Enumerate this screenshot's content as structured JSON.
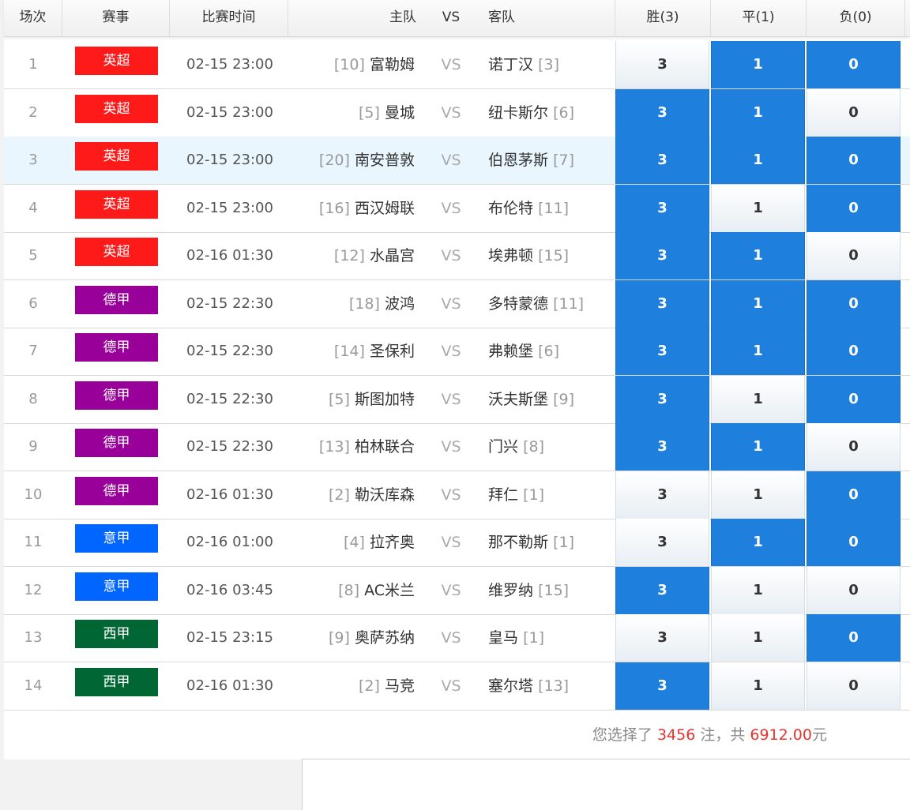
{
  "header": {
    "num": "场次",
    "league": "赛事",
    "time": "比赛时间",
    "home": "主队",
    "vs": "VS",
    "away": "客队",
    "win": "胜(3)",
    "draw": "平(1)",
    "lose": "负(0)"
  },
  "league_colors": {
    "英超": "#ff1a1a",
    "德甲": "#990099",
    "意甲": "#0066ff",
    "西甲": "#006633"
  },
  "selected_color": "#1f7fdc",
  "matches": [
    {
      "num": "1",
      "league": "英超",
      "time": "02-15 23:00",
      "home_rank": "[10]",
      "home": "富勒姆",
      "vs": "VS",
      "away": "诺丁汉",
      "away_rank": "[3]",
      "win": "3",
      "draw": "1",
      "lose": "0",
      "sel": [
        false,
        true,
        true
      ]
    },
    {
      "num": "2",
      "league": "英超",
      "time": "02-15 23:00",
      "home_rank": "[5]",
      "home": "曼城",
      "vs": "VS",
      "away": "纽卡斯尔",
      "away_rank": "[6]",
      "win": "3",
      "draw": "1",
      "lose": "0",
      "sel": [
        true,
        true,
        false
      ]
    },
    {
      "num": "3",
      "league": "英超",
      "time": "02-15 23:00",
      "home_rank": "[20]",
      "home": "南安普敦",
      "vs": "VS",
      "away": "伯恩茅斯",
      "away_rank": "[7]",
      "win": "3",
      "draw": "1",
      "lose": "0",
      "sel": [
        true,
        true,
        true
      ],
      "highlight": true
    },
    {
      "num": "4",
      "league": "英超",
      "time": "02-15 23:00",
      "home_rank": "[16]",
      "home": "西汉姆联",
      "vs": "VS",
      "away": "布伦特",
      "away_rank": "[11]",
      "win": "3",
      "draw": "1",
      "lose": "0",
      "sel": [
        true,
        false,
        true
      ]
    },
    {
      "num": "5",
      "league": "英超",
      "time": "02-16 01:30",
      "home_rank": "[12]",
      "home": "水晶宫",
      "vs": "VS",
      "away": "埃弗顿",
      "away_rank": "[15]",
      "win": "3",
      "draw": "1",
      "lose": "0",
      "sel": [
        true,
        true,
        false
      ]
    },
    {
      "num": "6",
      "league": "德甲",
      "time": "02-15 22:30",
      "home_rank": "[18]",
      "home": "波鸿",
      "vs": "VS",
      "away": "多特蒙德",
      "away_rank": "[11]",
      "win": "3",
      "draw": "1",
      "lose": "0",
      "sel": [
        true,
        true,
        true
      ]
    },
    {
      "num": "7",
      "league": "德甲",
      "time": "02-15 22:30",
      "home_rank": "[14]",
      "home": "圣保利",
      "vs": "VS",
      "away": "弗赖堡",
      "away_rank": "[6]",
      "win": "3",
      "draw": "1",
      "lose": "0",
      "sel": [
        true,
        true,
        true
      ]
    },
    {
      "num": "8",
      "league": "德甲",
      "time": "02-15 22:30",
      "home_rank": "[5]",
      "home": "斯图加特",
      "vs": "VS",
      "away": "沃夫斯堡",
      "away_rank": "[9]",
      "win": "3",
      "draw": "1",
      "lose": "0",
      "sel": [
        true,
        false,
        true
      ]
    },
    {
      "num": "9",
      "league": "德甲",
      "time": "02-15 22:30",
      "home_rank": "[13]",
      "home": "柏林联合",
      "vs": "VS",
      "away": "门兴",
      "away_rank": "[8]",
      "win": "3",
      "draw": "1",
      "lose": "0",
      "sel": [
        true,
        true,
        false
      ]
    },
    {
      "num": "10",
      "league": "德甲",
      "time": "02-16 01:30",
      "home_rank": "[2]",
      "home": "勒沃库森",
      "vs": "VS",
      "away": "拜仁",
      "away_rank": "[1]",
      "win": "3",
      "draw": "1",
      "lose": "0",
      "sel": [
        false,
        false,
        true
      ]
    },
    {
      "num": "11",
      "league": "意甲",
      "time": "02-16 01:00",
      "home_rank": "[4]",
      "home": "拉齐奥",
      "vs": "VS",
      "away": "那不勒斯",
      "away_rank": "[1]",
      "win": "3",
      "draw": "1",
      "lose": "0",
      "sel": [
        false,
        true,
        true
      ]
    },
    {
      "num": "12",
      "league": "意甲",
      "time": "02-16 03:45",
      "home_rank": "[8]",
      "home": "AC米兰",
      "vs": "VS",
      "away": "维罗纳",
      "away_rank": "[15]",
      "win": "3",
      "draw": "1",
      "lose": "0",
      "sel": [
        true,
        false,
        false
      ]
    },
    {
      "num": "13",
      "league": "西甲",
      "time": "02-15 23:15",
      "home_rank": "[9]",
      "home": "奥萨苏纳",
      "vs": "VS",
      "away": "皇马",
      "away_rank": "[1]",
      "win": "3",
      "draw": "1",
      "lose": "0",
      "sel": [
        false,
        false,
        true
      ]
    },
    {
      "num": "14",
      "league": "西甲",
      "time": "02-16 01:30",
      "home_rank": "[2]",
      "home": "马竞",
      "vs": "VS",
      "away": "塞尔塔",
      "away_rank": "[13]",
      "win": "3",
      "draw": "1",
      "lose": "0",
      "sel": [
        true,
        false,
        false
      ]
    }
  ],
  "summary": {
    "prefix": "您选择了",
    "bets": "3456",
    "mid": "注，共",
    "amount": "6912.00",
    "suffix": "元"
  }
}
